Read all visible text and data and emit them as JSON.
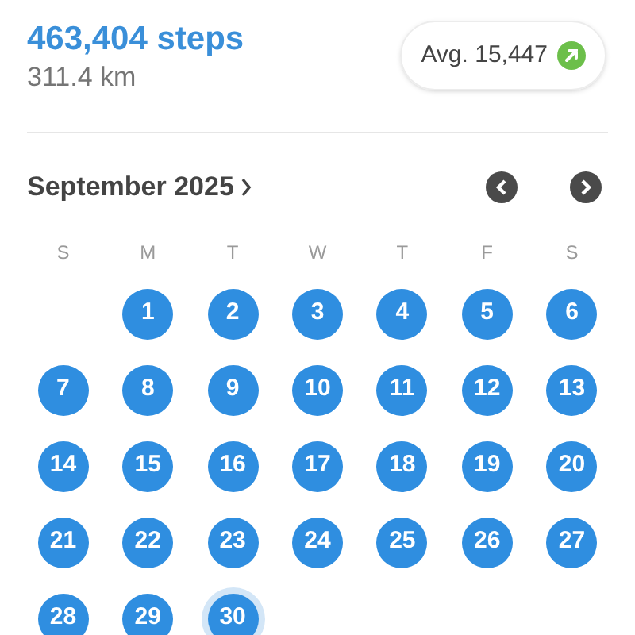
{
  "summary": {
    "steps": "463,404 steps",
    "distance": "311.4 km",
    "average": "Avg. 15,447"
  },
  "calendar": {
    "month": "September 2025",
    "weekdays": [
      "S",
      "M",
      "T",
      "W",
      "T",
      "F",
      "S"
    ],
    "weeks": [
      [
        {
          "kind": "empty"
        },
        {
          "kind": "day",
          "day": "1",
          "selected": false
        },
        {
          "kind": "day",
          "day": "2",
          "selected": false
        },
        {
          "kind": "day",
          "day": "3",
          "selected": false
        },
        {
          "kind": "day",
          "day": "4",
          "selected": false
        },
        {
          "kind": "day",
          "day": "5",
          "selected": false
        },
        {
          "kind": "day",
          "day": "6",
          "selected": false
        }
      ],
      [
        {
          "kind": "day",
          "day": "7",
          "selected": false
        },
        {
          "kind": "day",
          "day": "8",
          "selected": false
        },
        {
          "kind": "day",
          "day": "9",
          "selected": false
        },
        {
          "kind": "day",
          "day": "10",
          "selected": false
        },
        {
          "kind": "day",
          "day": "11",
          "selected": false
        },
        {
          "kind": "day",
          "day": "12",
          "selected": false
        },
        {
          "kind": "day",
          "day": "13",
          "selected": false
        }
      ],
      [
        {
          "kind": "day",
          "day": "14",
          "selected": false
        },
        {
          "kind": "day",
          "day": "15",
          "selected": false
        },
        {
          "kind": "day",
          "day": "16",
          "selected": false
        },
        {
          "kind": "day",
          "day": "17",
          "selected": false
        },
        {
          "kind": "day",
          "day": "18",
          "selected": false
        },
        {
          "kind": "day",
          "day": "19",
          "selected": false
        },
        {
          "kind": "day",
          "day": "20",
          "selected": false
        }
      ],
      [
        {
          "kind": "day",
          "day": "21",
          "selected": false
        },
        {
          "kind": "day",
          "day": "22",
          "selected": false
        },
        {
          "kind": "day",
          "day": "23",
          "selected": false
        },
        {
          "kind": "day",
          "day": "24",
          "selected": false
        },
        {
          "kind": "day",
          "day": "25",
          "selected": false
        },
        {
          "kind": "day",
          "day": "26",
          "selected": false
        },
        {
          "kind": "day",
          "day": "27",
          "selected": false
        }
      ],
      [
        {
          "kind": "day",
          "day": "28",
          "selected": false
        },
        {
          "kind": "day",
          "day": "29",
          "selected": false
        },
        {
          "kind": "day",
          "day": "30",
          "selected": true
        }
      ]
    ]
  }
}
